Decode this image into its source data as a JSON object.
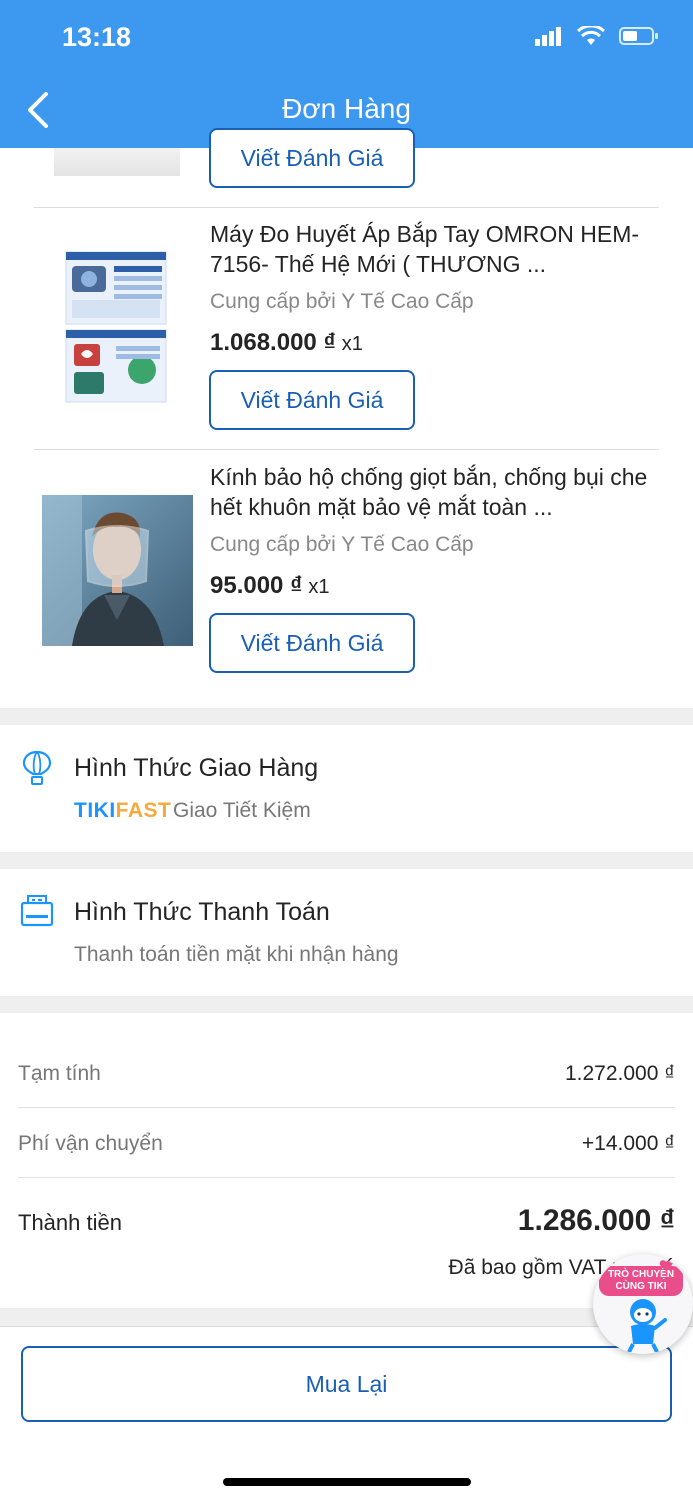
{
  "status_bar": {
    "time": "13:18"
  },
  "header": {
    "title": "Đơn Hàng"
  },
  "review_label": "Viết Đánh Giá",
  "products": [
    {
      "name": "Máy Đo Huyết Áp Bắp Tay OMRON HEM-7156- Thế Hệ Mới ( THƯƠNG ...",
      "seller": "Cung cấp bởi Y Tế Cao Cấp",
      "price": "1.068.000 ₫",
      "qty": "x1",
      "thumb_brand": "omron"
    },
    {
      "name": "Kính bảo hộ  chống giọt bắn, chống bụi che hết khuôn mặt bảo vệ mắt toàn ...",
      "seller": "Cung cấp bởi Y Tế Cao Cấp",
      "price": "95.000 ₫",
      "qty": "x1"
    }
  ],
  "shipping": {
    "title": "Hình Thức Giao Hàng",
    "brand_a": "TIKI",
    "brand_b": "FAST",
    "method": "Giao Tiết Kiệm"
  },
  "payment": {
    "title": "Hình Thức Thanh Toán",
    "method": "Thanh toán tiền mặt khi nhận hàng"
  },
  "summary": {
    "subtotal_label": "Tạm tính",
    "subtotal_value": "1.272.000 ₫",
    "shipping_label": "Phí vận chuyển",
    "shipping_value": "+14.000 ₫",
    "total_label": "Thành tiền",
    "total_value": "1.286.000 ₫",
    "vat_note": "Đã bao gồm VAT nếu có"
  },
  "buy_again_label": "Mua Lại",
  "chat": {
    "label": "TRÒ CHUYỆN CÙNG TIKI"
  },
  "colors": {
    "header": "#3d99f0",
    "accent": "#1a5fb4",
    "tikifast_blue": "#1a94ff",
    "tikifast_orange": "#f6a93b"
  }
}
